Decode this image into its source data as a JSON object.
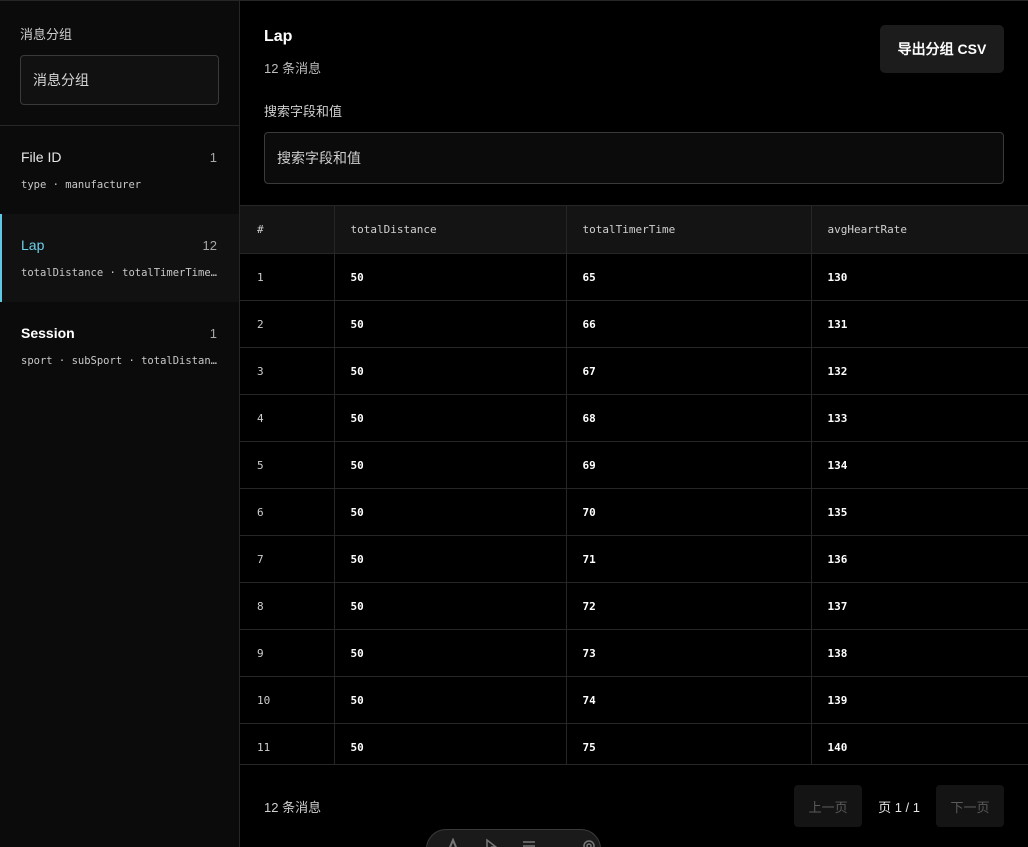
{
  "sidebar": {
    "title": "消息分组",
    "search_placeholder": "消息分组",
    "groups": [
      {
        "name": "File ID",
        "count": "1",
        "fields": "type · manufacturer"
      },
      {
        "name": "Lap",
        "count": "12",
        "fields": "totalDistance · totalTimerTime …"
      },
      {
        "name": "Session",
        "count": "1",
        "fields": "sport · subSport · totalDistanc…"
      }
    ]
  },
  "main": {
    "title": "Lap",
    "count": "12 条消息",
    "export_label": "导出分组 CSV",
    "search_label": "搜索字段和值",
    "search_placeholder": "搜索字段和值"
  },
  "table": {
    "columns": [
      "#",
      "totalDistance",
      "totalTimerTime",
      "avgHeartRate"
    ],
    "rows": [
      [
        "1",
        "50",
        "65",
        "130"
      ],
      [
        "2",
        "50",
        "66",
        "131"
      ],
      [
        "3",
        "50",
        "67",
        "132"
      ],
      [
        "4",
        "50",
        "68",
        "133"
      ],
      [
        "5",
        "50",
        "69",
        "134"
      ],
      [
        "6",
        "50",
        "70",
        "135"
      ],
      [
        "7",
        "50",
        "71",
        "136"
      ],
      [
        "8",
        "50",
        "72",
        "137"
      ],
      [
        "9",
        "50",
        "73",
        "138"
      ],
      [
        "10",
        "50",
        "74",
        "139"
      ],
      [
        "11",
        "50",
        "75",
        "140"
      ]
    ]
  },
  "footer": {
    "count": "12 条消息",
    "prev_label": "上一页",
    "page_info": "页 1 / 1",
    "next_label": "下一页"
  },
  "colors": {
    "accent": "#5ec8e5",
    "background": "#000000",
    "sidebar_bg": "#0b0b0b"
  },
  "toolbar_icons": [
    "text-icon",
    "pointer-icon",
    "menu-icon",
    "gear-icon"
  ]
}
